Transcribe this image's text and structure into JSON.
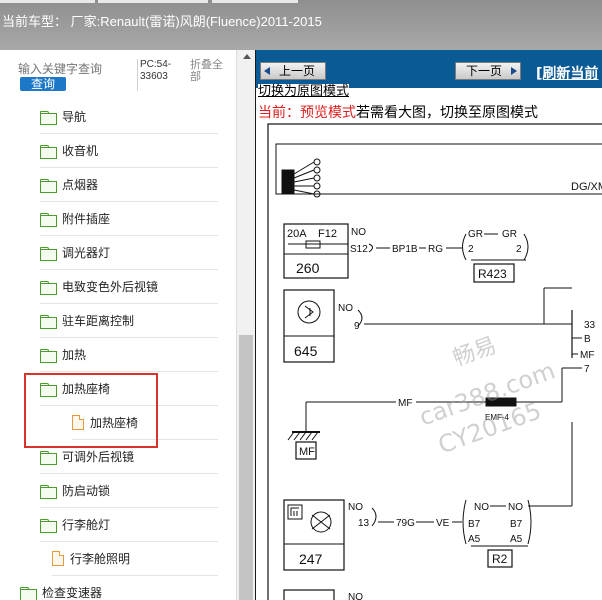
{
  "header": {
    "title": "当前车型： 厂家:Renault(雷诺)风朗(Fluence)2011-2015"
  },
  "sidebar": {
    "search_placeholder": "输入关键字查询",
    "search_button": "查询",
    "pc_code": "PC:54-33603",
    "collapse_all": "折叠全部",
    "items": [
      {
        "label": "导航",
        "icon": "folder-icon"
      },
      {
        "label": "收音机",
        "icon": "folder-icon"
      },
      {
        "label": "点烟器",
        "icon": "folder-icon"
      },
      {
        "label": "附件插座",
        "icon": "folder-icon"
      },
      {
        "label": "调光器灯",
        "icon": "folder-icon"
      },
      {
        "label": "电致变色外后视镜",
        "icon": "folder-icon"
      },
      {
        "label": "驻车距离控制",
        "icon": "folder-icon"
      },
      {
        "label": "加热",
        "icon": "folder-icon"
      },
      {
        "label": "加热座椅",
        "icon": "folder-open-icon"
      },
      {
        "label": "加热座椅",
        "icon": "document-icon"
      },
      {
        "label": "可调外后视镜",
        "icon": "folder-icon"
      },
      {
        "label": "防启动锁",
        "icon": "folder-icon"
      },
      {
        "label": "行李舱灯",
        "icon": "folder-open-icon"
      },
      {
        "label": "行李舱照明",
        "icon": "document-icon"
      },
      {
        "label": "检查变速器",
        "icon": "folder-icon"
      }
    ]
  },
  "viewer": {
    "prev_button": "上一页",
    "next_button": "下一页",
    "refresh_link": "[刷新当前",
    "switch_link": "切换为原图模式",
    "mode_current": "当前：",
    "mode_name": "预览模式",
    "mode_hint": "若需看大图，切换至原图模式"
  },
  "diagram": {
    "header_code": "DG/XM",
    "c1_fuse": "20A",
    "c1_f": "F12",
    "c1_num": "260",
    "w_no1": "NO",
    "w_s12": "S12",
    "w_bp1b": "BP1B",
    "w_rg": "RG",
    "w_gr1": "GR",
    "w_gr2": "GR",
    "pin_2a": "2",
    "pin_2b": "2",
    "c_r423": "R423",
    "c2_num": "645",
    "w_no2": "NO",
    "pin_9": "9",
    "r_33": "33",
    "r_b": "B",
    "r_mf": "MF",
    "r_7": "7",
    "w_mf": "MF",
    "c_emf4": "EMF-4",
    "ground_mf": "MF",
    "c3_num": "247",
    "w_no3": "NO",
    "pin_13": "13",
    "w_79g": "79G",
    "w_ve": "VE",
    "w_no4": "NO",
    "w_no5": "NO",
    "pin_b7a": "B7",
    "pin_a5a": "A5",
    "pin_b7b": "B7",
    "pin_a5b": "A5",
    "c_r2": "R2",
    "w_no6": "NO"
  },
  "watermark": {
    "line1": "畅易",
    "line2": "car388.com",
    "line3": "CY20165"
  }
}
